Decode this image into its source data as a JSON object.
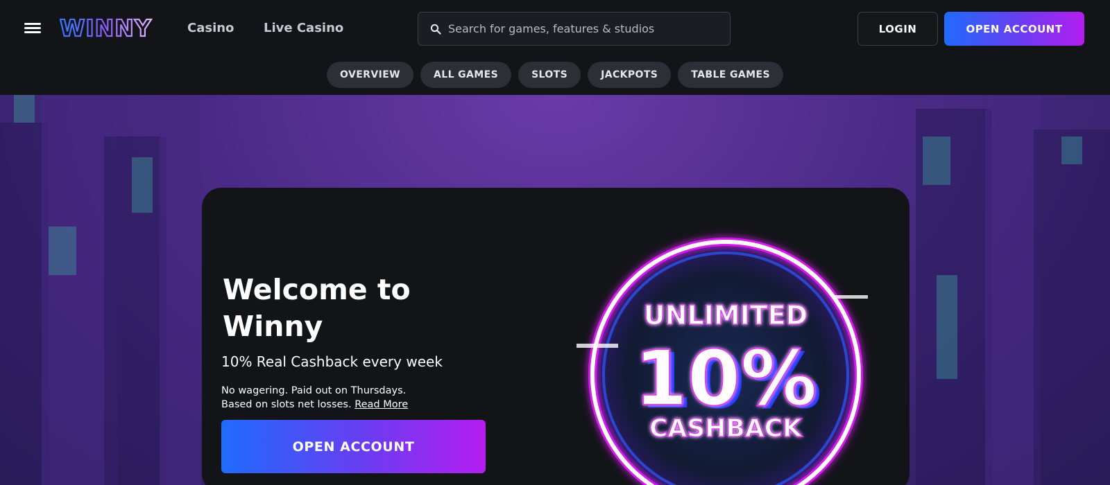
{
  "header": {
    "brand": "WINNY",
    "nav": {
      "casino": "Casino",
      "live_casino": "Live Casino"
    },
    "search": {
      "placeholder": "Search for games, features & studios",
      "value": ""
    },
    "login_label": "LOGIN",
    "open_account_label": "OPEN ACCOUNT"
  },
  "tabs": [
    {
      "label": "OVERVIEW"
    },
    {
      "label": "ALL GAMES"
    },
    {
      "label": "SLOTS"
    },
    {
      "label": "JACKPOTS"
    },
    {
      "label": "TABLE GAMES"
    }
  ],
  "hero": {
    "title": "Welcome to Winny",
    "subtitle": "10% Real Cashback every week",
    "details_line1": "No wagering. Paid out on Thursdays.",
    "details_line2": "Based on slots net losses.",
    "read_more": "Read More",
    "cta_label": "OPEN ACCOUNT",
    "badge": {
      "line1": "UNLIMITED",
      "line2": "10%",
      "line3": "CASHBACK"
    }
  },
  "colors": {
    "accent_blue": "#1f6bff",
    "accent_magenta": "#b51df0",
    "header_bg": "#121418",
    "tab_bg": "#2c2f35",
    "hero_purple": "#4a2a86"
  },
  "icons": {
    "menu": "hamburger-icon",
    "search": "search-icon"
  }
}
